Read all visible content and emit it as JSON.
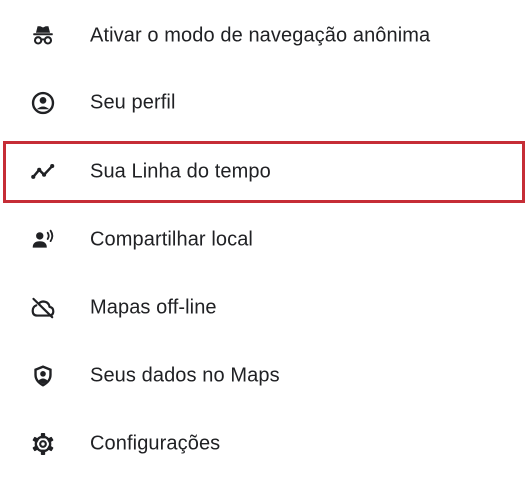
{
  "menu": {
    "items": [
      {
        "label": "Ativar o modo de navegação anônima",
        "icon": "incognito-icon"
      },
      {
        "label": "Seu perfil",
        "icon": "account-circle-icon"
      },
      {
        "label": "Sua Linha do tempo",
        "icon": "timeline-icon"
      },
      {
        "label": "Compartilhar local",
        "icon": "share-location-icon"
      },
      {
        "label": "Mapas off-line",
        "icon": "cloud-off-icon"
      },
      {
        "label": "Seus dados no Maps",
        "icon": "shield-account-icon"
      },
      {
        "label": "Configurações",
        "icon": "gear-icon"
      }
    ],
    "highlighted_item": "Sua Linha do tempo"
  },
  "colors": {
    "text": "#202124",
    "icon": "#202124",
    "highlight_border": "#c62d36",
    "background": "#ffffff"
  }
}
